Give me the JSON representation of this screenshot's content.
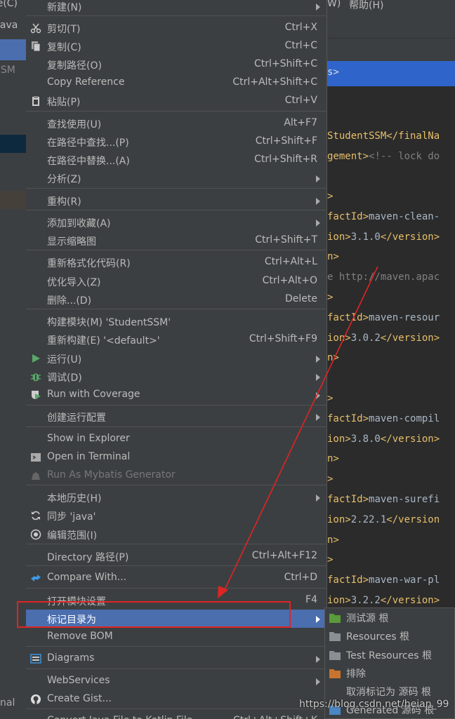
{
  "left_strip": {
    "items": [
      "œ(C)",
      "java",
      "SSM",
      "nal"
    ]
  },
  "menubar": {
    "items": [
      "W)",
      "帮助(H)"
    ]
  },
  "breadcrumb": {
    "selected": "s>"
  },
  "code_lines": [
    {
      "parts": [
        [
          "tag",
          "StudentSSM</finalNa"
        ]
      ]
    },
    {
      "parts": [
        [
          "tag",
          "gement>"
        ],
        [
          "cmt",
          "<!-- lock do"
        ]
      ]
    },
    {
      "parts": [
        [
          "tag",
          ">"
        ]
      ]
    },
    {
      "parts": [
        [
          "tag",
          "factId>"
        ],
        [
          "txt",
          "maven-clean-"
        ]
      ]
    },
    {
      "parts": [
        [
          "tag",
          "ion>"
        ],
        [
          "txt",
          "3.1.0"
        ],
        [
          "tag",
          "</version>"
        ]
      ]
    },
    {
      "parts": [
        [
          "tag",
          "n>"
        ]
      ]
    },
    {
      "parts": [
        [
          "cmt",
          "e http://maven.apac"
        ]
      ]
    },
    {
      "parts": [
        [
          "tag",
          ">"
        ]
      ]
    },
    {
      "parts": [
        [
          "tag",
          "factId>"
        ],
        [
          "txt",
          "maven-resour"
        ]
      ]
    },
    {
      "parts": [
        [
          "tag",
          "ion>"
        ],
        [
          "txt",
          "3.0.2"
        ],
        [
          "tag",
          "</version>"
        ]
      ]
    },
    {
      "parts": [
        [
          "tag",
          "n>"
        ]
      ]
    },
    {
      "parts": [
        [
          "tag",
          ">"
        ]
      ]
    },
    {
      "parts": [
        [
          "tag",
          "factId>"
        ],
        [
          "txt",
          "maven-compil"
        ]
      ]
    },
    {
      "parts": [
        [
          "tag",
          "ion>"
        ],
        [
          "txt",
          "3.8.0"
        ],
        [
          "tag",
          "</version>"
        ]
      ]
    },
    {
      "parts": [
        [
          "tag",
          "n>"
        ]
      ]
    },
    {
      "parts": [
        [
          "tag",
          ">"
        ]
      ]
    },
    {
      "parts": [
        [
          "tag",
          "factId>"
        ],
        [
          "txt",
          "maven-surefi"
        ]
      ]
    },
    {
      "parts": [
        [
          "tag",
          "ion>"
        ],
        [
          "txt",
          "2.22.1"
        ],
        [
          "tag",
          "</version"
        ]
      ]
    },
    {
      "parts": [
        [
          "tag",
          "n>"
        ]
      ]
    },
    {
      "parts": [
        [
          "tag",
          ">"
        ]
      ]
    },
    {
      "parts": [
        [
          "tag",
          "factId>"
        ],
        [
          "txt",
          "maven-war-pl"
        ]
      ]
    },
    {
      "parts": [
        [
          "tag",
          "ion>"
        ],
        [
          "txt",
          "3.2.2"
        ],
        [
          "tag",
          "</version>"
        ]
      ]
    },
    {
      "parts": [
        [
          "tag",
          "n>"
        ]
      ]
    }
  ],
  "menu": {
    "items": [
      {
        "label": "新建(N)",
        "shortcut": "",
        "submenu": true,
        "icon": ""
      },
      {
        "label": "剪切(T)",
        "shortcut": "Ctrl+X",
        "icon": "scissors-icon"
      },
      {
        "label": "复制(C)",
        "shortcut": "Ctrl+C",
        "icon": "copy-icon"
      },
      {
        "label": "复制路径(O)",
        "shortcut": "Ctrl+Shift+C",
        "icon": ""
      },
      {
        "label": "Copy Reference",
        "shortcut": "Ctrl+Alt+Shift+C",
        "icon": ""
      },
      {
        "label": "粘贴(P)",
        "shortcut": "Ctrl+V",
        "icon": "clipboard-icon"
      },
      {
        "label": "查找使用(U)",
        "shortcut": "Alt+F7",
        "icon": ""
      },
      {
        "label": "在路径中查找...(P)",
        "shortcut": "Ctrl+Shift+F",
        "icon": ""
      },
      {
        "label": "在路径中替换...(A)",
        "shortcut": "Ctrl+Shift+R",
        "icon": ""
      },
      {
        "label": "分析(Z)",
        "shortcut": "",
        "submenu": true,
        "icon": ""
      },
      {
        "label": "重构(R)",
        "shortcut": "",
        "submenu": true,
        "icon": ""
      },
      {
        "label": "添加到收藏(A)",
        "shortcut": "",
        "submenu": true,
        "icon": ""
      },
      {
        "label": "显示缩略图",
        "shortcut": "Ctrl+Shift+T",
        "icon": ""
      },
      {
        "label": "重新格式化代码(R)",
        "shortcut": "Ctrl+Alt+L",
        "icon": ""
      },
      {
        "label": "优化导入(Z)",
        "shortcut": "Ctrl+Alt+O",
        "icon": ""
      },
      {
        "label": "删除...(D)",
        "shortcut": "Delete",
        "icon": ""
      },
      {
        "label": "构建模块(M) 'StudentSSM'",
        "shortcut": "",
        "icon": ""
      },
      {
        "label": "重新构建(E) '<default>'",
        "shortcut": "Ctrl+Shift+F9",
        "icon": ""
      },
      {
        "label": "运行(U)",
        "shortcut": "",
        "submenu": true,
        "icon": "run-icon"
      },
      {
        "label": "调试(D)",
        "shortcut": "",
        "submenu": true,
        "icon": "debug-icon"
      },
      {
        "label": "Run with Coverage",
        "shortcut": "",
        "submenu": true,
        "icon": "coverage-icon"
      },
      {
        "label": "创建运行配置",
        "shortcut": "",
        "submenu": true,
        "icon": ""
      },
      {
        "label": "Show in Explorer",
        "shortcut": "",
        "icon": ""
      },
      {
        "label": "Open in Terminal",
        "shortcut": "",
        "icon": "terminal-icon"
      },
      {
        "label": "Run As Mybatis Generator",
        "shortcut": "",
        "icon": "mybatis-icon",
        "disabled": true
      },
      {
        "label": "本地历史(H)",
        "shortcut": "",
        "submenu": true,
        "icon": ""
      },
      {
        "label": "同步 'java'",
        "shortcut": "",
        "icon": "sync-icon"
      },
      {
        "label": "编辑范围(I)",
        "shortcut": "",
        "icon": "scope-icon"
      },
      {
        "label": "Directory 路径(P)",
        "shortcut": "Ctrl+Alt+F12",
        "icon": ""
      },
      {
        "label": "Compare With...",
        "shortcut": "Ctrl+D",
        "icon": "compare-icon"
      },
      {
        "label": "打开模块设置",
        "shortcut": "F4",
        "icon": ""
      },
      {
        "label": "标记目录为",
        "shortcut": "",
        "submenu": true,
        "icon": "",
        "selected": true
      },
      {
        "label": "Remove BOM",
        "shortcut": "",
        "icon": ""
      },
      {
        "label": "Diagrams",
        "shortcut": "",
        "submenu": true,
        "icon": "diagrams-icon"
      },
      {
        "label": "WebServices",
        "shortcut": "",
        "submenu": true,
        "icon": ""
      },
      {
        "label": "Create Gist...",
        "shortcut": "",
        "icon": "github-icon"
      },
      {
        "label": "Convert Java File to Kotlin File",
        "shortcut": "Ctrl+Alt+Shift+K",
        "icon": ""
      }
    ]
  },
  "submenu": {
    "items": [
      {
        "label": "测试源 根",
        "color": "#5a9a3a"
      },
      {
        "label": "Resources 根",
        "color": "#8a8f96"
      },
      {
        "label": "Test Resources 根",
        "color": "#8a8f96"
      },
      {
        "label": "排除",
        "color": "#c8742e"
      },
      {
        "label": "取消标记为 源码 根",
        "color": ""
      },
      {
        "label": "Generated 源码 根",
        "color": "#4a86c5"
      }
    ]
  },
  "watermark": "https://blog.csdn.net/heian_99",
  "colors": {
    "selection": "#4b6eaf",
    "annotation": "#e02424"
  }
}
